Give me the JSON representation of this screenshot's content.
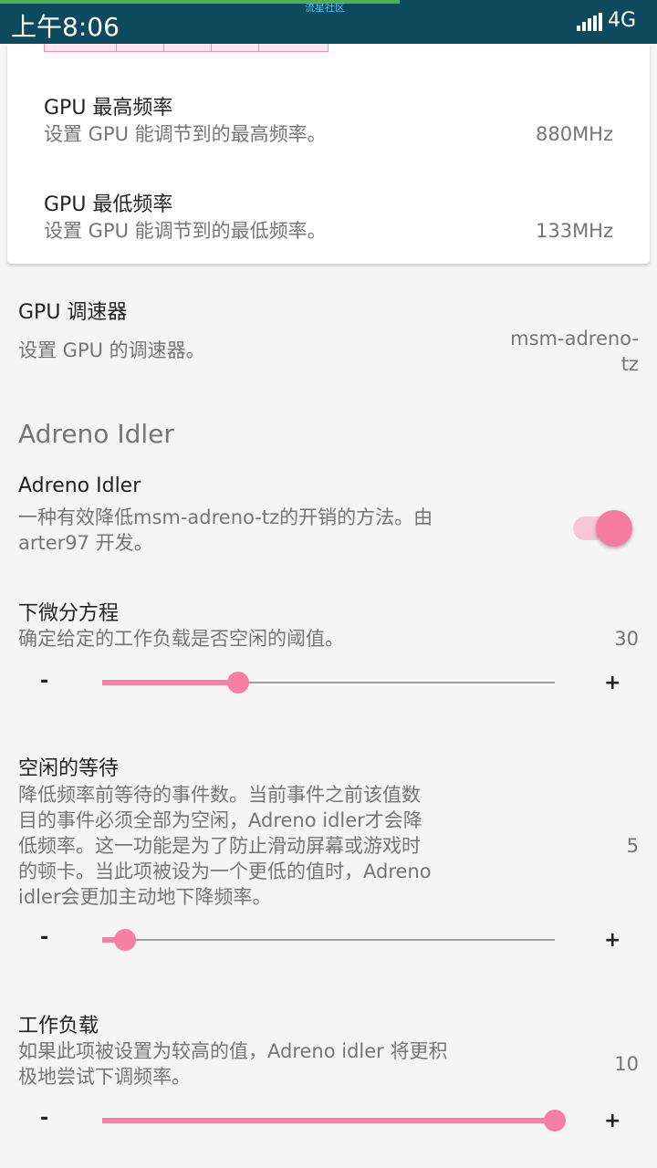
{
  "status_bar": {
    "time": "上午8:06",
    "toast": "流星社区",
    "network": "4G"
  },
  "card": {
    "max_freq": {
      "title": "GPU 最高频率",
      "summary": "设置 GPU 能调节到的最高频率。",
      "value": "880MHz"
    },
    "min_freq": {
      "title": "GPU 最低频率",
      "summary": "设置 GPU 能调节到的最低频率。",
      "value": "133MHz"
    }
  },
  "governor": {
    "title": "GPU 调速器",
    "summary": "设置 GPU 的调速器。",
    "value_line1": "msm-adreno-",
    "value_line2": "tz"
  },
  "adreno_section": {
    "header": "Adreno Idler",
    "switch": {
      "title": "Adreno Idler",
      "summary_line1": "一种有效降低msm-adreno-tz的开销的方法。由",
      "summary_line2": "arter97 开发。",
      "enabled": true
    },
    "threshold": {
      "title": "下微分方程",
      "summary": "确定给定的工作负载是否空闲的阈值。",
      "value": "30",
      "minus": "-",
      "plus": "+",
      "fraction": 0.3
    },
    "idle_wait": {
      "title": "空闲的等待",
      "summary_lines": [
        "降低频率前等待的事件数。当前事件之前该值数",
        "目的事件必须全部为空闲，Adreno idler才会降",
        "低频率。这一功能是为了防止滑动屏幕或游戏时",
        "的顿卡。当此项被设为一个更低的值时，Adreno",
        "idler会更加主动地下降频率。"
      ],
      "value": "5",
      "minus": "-",
      "plus": "+",
      "fraction": 0.05
    },
    "workload": {
      "title": "工作负载",
      "summary_lines": [
        "如果此项被设置为较高的值，Adreno idler 将更积",
        "极地尝试下调频率。"
      ],
      "value": "10",
      "minus": "-",
      "plus": "+",
      "fraction": 1.0
    }
  },
  "colors": {
    "accent": "#f77fa6",
    "status_bar": "#0d4a5e"
  }
}
